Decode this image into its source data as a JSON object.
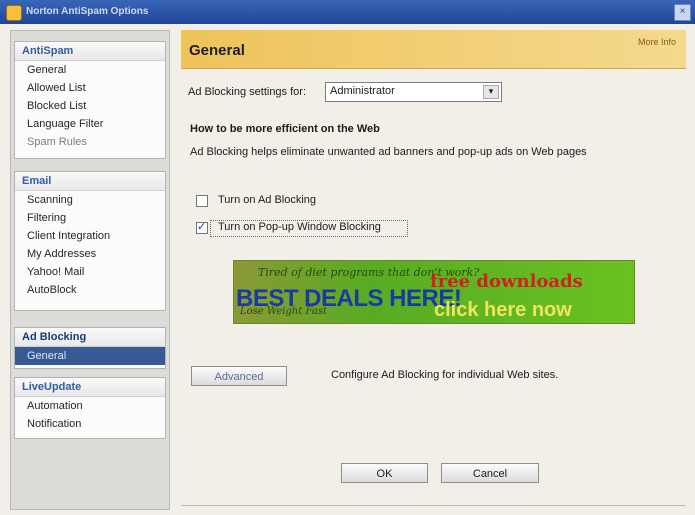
{
  "window": {
    "title": "Norton AntiSpam Options"
  },
  "sidebar": {
    "groups": [
      {
        "title": "AntiSpam",
        "items": [
          "General",
          "Allowed List",
          "Blocked List",
          "Language Filter",
          "Spam Rules"
        ]
      },
      {
        "title": "Email",
        "items": [
          "Scanning",
          "Filtering",
          "Client Integration",
          "My Addresses",
          "Yahoo! Mail",
          "AutoBlock"
        ]
      },
      {
        "title": "Ad Blocking",
        "items": [
          "General"
        ]
      },
      {
        "title": "LiveUpdate",
        "items": [
          "Automation",
          "Notification"
        ]
      }
    ]
  },
  "main": {
    "title": "General",
    "help_link": "More Info",
    "settings_label": "Ad Blocking settings for:",
    "settings_value": "Administrator",
    "section_title": "How to be more efficient on the Web",
    "description": "Ad Blocking helps eliminate unwanted ad banners and pop-up ads on Web pages",
    "options": [
      {
        "label": "Turn on Ad Blocking",
        "checked": false
      },
      {
        "label": "Turn on Pop-up Window Blocking",
        "checked": true
      }
    ],
    "banner": {
      "small_text": "Tired of diet programs that don't work?",
      "big_text": "BEST DEALS HERE!",
      "red_text": "free downloads",
      "lower_text": "Lose Weight Fast",
      "click_text": "click here now"
    },
    "advanced_button": "Advanced",
    "advanced_description": "Configure Ad Blocking for individual Web sites.",
    "ok_button": "OK",
    "cancel_button": "Cancel"
  }
}
